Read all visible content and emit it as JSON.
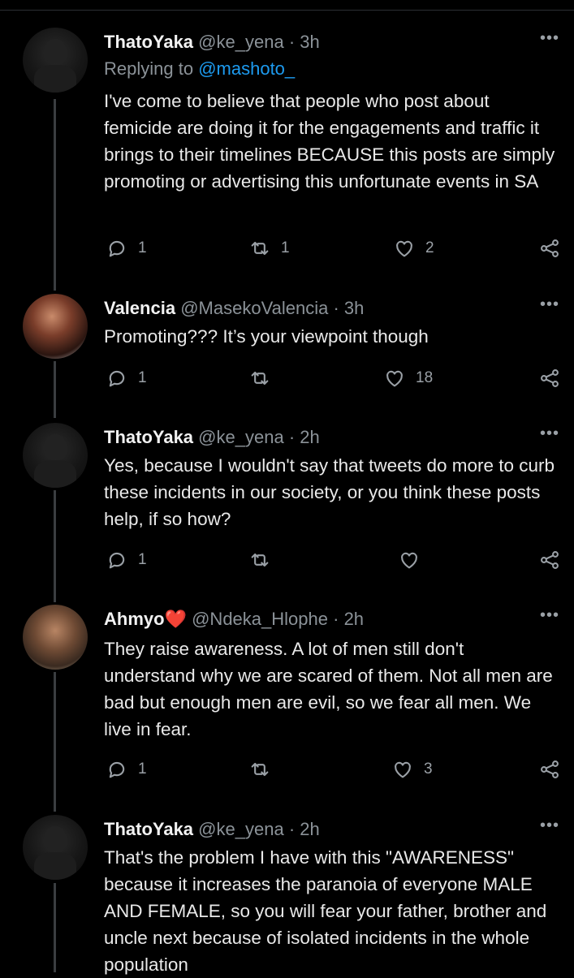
{
  "tweets": [
    {
      "name": "ThatoYaka",
      "handle": "@ke_yena",
      "time": "3h",
      "replying_prefix": "Replying to",
      "replying_to": "@mashoto_",
      "text": "I've come to believe that people who post about femicide are doing it for the engagements and traffic it brings to their timelines BECAUSE this posts are simply promoting or advertising this unfortunate events in SA",
      "replies": "1",
      "retweets": "1",
      "likes": "2"
    },
    {
      "name": "Valencia",
      "handle": "@MasekoValencia",
      "time": "3h",
      "text": "Promoting??? It’s your viewpoint though",
      "replies": "1",
      "retweets": "",
      "likes": "18"
    },
    {
      "name": "ThatoYaka",
      "handle": "@ke_yena",
      "time": "2h",
      "text": "Yes, because I wouldn't say that tweets do more to curb these incidents in our society, or you think these posts help, if so how?",
      "replies": "1",
      "retweets": "",
      "likes": ""
    },
    {
      "name": "Ahmyo",
      "name_emoji": "red-heart",
      "handle": "@Ndeka_Hlophe",
      "time": "2h",
      "text": "They raise awareness. A lot of men still don't understand why we are scared of them. Not all men are bad but enough men are evil, so we fear all men. We live in fear.",
      "replies": "1",
      "retweets": "",
      "likes": "3"
    },
    {
      "name": "ThatoYaka",
      "handle": "@ke_yena",
      "time": "2h",
      "text": "That's the problem I have with this \"AWARENESS\" because it increases the paranoia of everyone MALE AND FEMALE, so you will fear your father, brother and uncle next because of isolated incidents in the whole population"
    }
  ],
  "ui": {
    "separator": "·",
    "more": "•••"
  },
  "colors": {
    "background": "#000000",
    "link": "#1d9bf0",
    "muted": "#8b9298",
    "heart": "#e0245e"
  }
}
